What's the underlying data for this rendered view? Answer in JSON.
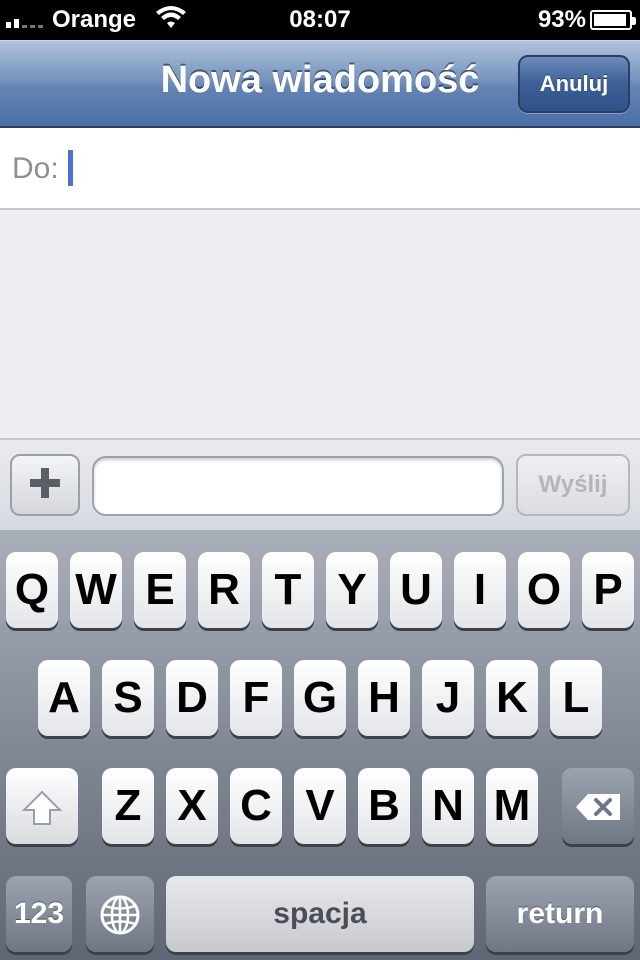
{
  "status_bar": {
    "carrier": "Orange",
    "time": "08:07",
    "battery_percent": "93%",
    "battery_level": 0.93,
    "signal_bars": 2
  },
  "nav": {
    "title": "Nowa wiadomość",
    "cancel_label": "Anuluj"
  },
  "to_field": {
    "label": "Do:",
    "value": ""
  },
  "composer": {
    "attach_icon": "plus-icon",
    "message_value": "",
    "send_label": "Wyślij",
    "send_enabled": false
  },
  "keyboard": {
    "row1": [
      "Q",
      "W",
      "E",
      "R",
      "T",
      "Y",
      "U",
      "I",
      "O",
      "P"
    ],
    "row2": [
      "A",
      "S",
      "D",
      "F",
      "G",
      "H",
      "J",
      "K",
      "L"
    ],
    "row3": [
      "Z",
      "X",
      "C",
      "V",
      "B",
      "N",
      "M"
    ],
    "numbers_label": "123",
    "space_label": "spacja",
    "return_label": "return",
    "shift_icon": "shift-arrow-icon",
    "delete_icon": "backspace-icon",
    "globe_icon": "globe-icon"
  },
  "colors": {
    "accent": "#4c6fdc",
    "nav_bar": "#6483b3"
  }
}
